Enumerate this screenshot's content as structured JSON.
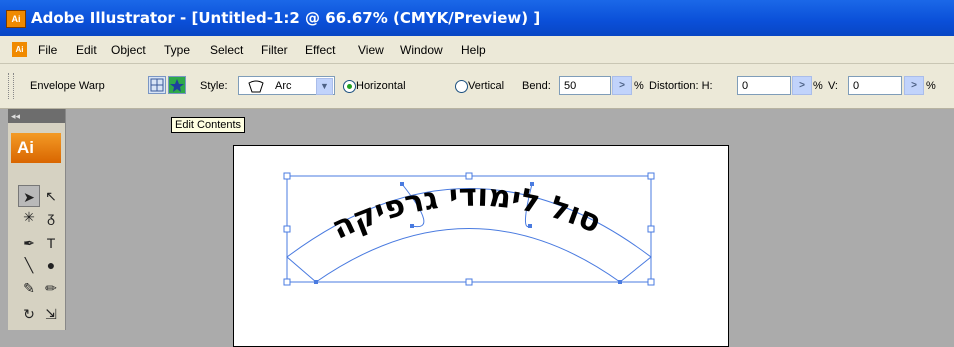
{
  "window": {
    "app_icon": "Ai",
    "title": "Adobe Illustrator - [Untitled-1:2 @ 66.67% (CMYK/Preview) ]"
  },
  "menu": {
    "icon": "Ai",
    "items": [
      "File",
      "Edit",
      "Object",
      "Type",
      "Select",
      "Filter",
      "Effect",
      "View",
      "Window",
      "Help"
    ]
  },
  "control": {
    "label": "Envelope Warp",
    "style_label": "Style:",
    "style_value": "Arc",
    "horizontal_label": "Horizontal",
    "vertical_label": "Vertical",
    "orientation_selected": "Horizontal",
    "bend_label": "Bend:",
    "bend_value": "50",
    "percent": "%",
    "distortion_label": "Distortion: H:",
    "h_value": "0",
    "v_label": "V:",
    "v_value": "0"
  },
  "tooltip": "Edit Contents",
  "tools": {
    "header": "◂◂",
    "logo": "Ai"
  },
  "artwork": {
    "text": "סול לימודי גרפיקה"
  },
  "colors": {
    "titlebar": "#0a4fd8",
    "selection": "#4a7be0",
    "ai_orange": "#f08a00"
  }
}
